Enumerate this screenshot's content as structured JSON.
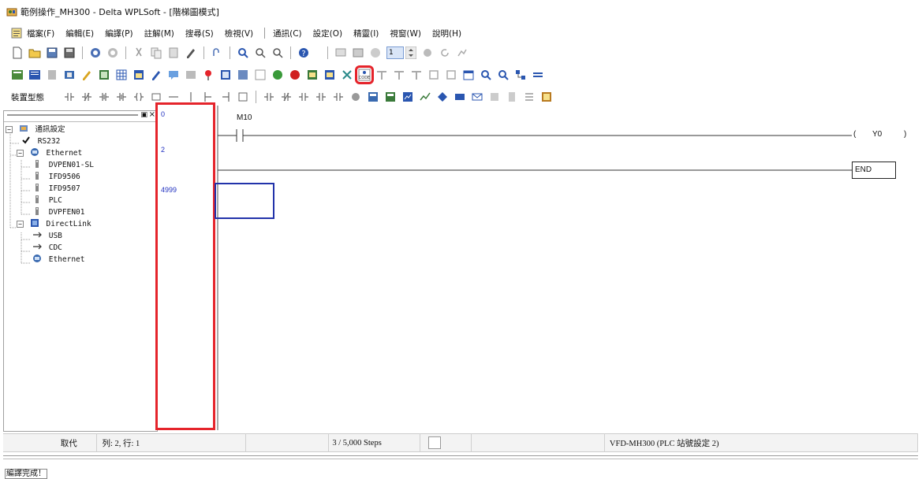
{
  "window": {
    "title": "範例操作_MH300 - Delta WPLSoft - [階梯圖模式]"
  },
  "menu": {
    "items": [
      "檔案(F)",
      "編輯(E)",
      "編譯(P)",
      "註解(M)",
      "搜尋(S)",
      "檢視(V)",
      "通訊(C)",
      "設定(O)",
      "精靈(I)",
      "視窗(W)",
      "說明(H)"
    ]
  },
  "toolbar": {
    "station_value": "1",
    "device_label": "裝置型態"
  },
  "tree": {
    "root": "通訊設定",
    "rs232": "RS232",
    "ethernet": "Ethernet",
    "ethernet_children": [
      "DVPEN01-SL",
      "IFD9506",
      "IFD9507",
      "PLC",
      "DVPFEN01"
    ],
    "directlink": "DirectLink",
    "directlink_children": [
      "USB",
      "CDC",
      "Ethernet"
    ]
  },
  "ladder": {
    "step_numbers": [
      "0",
      "2",
      "4999"
    ],
    "contact": "M10",
    "coil": "Y0",
    "end": "END"
  },
  "status": {
    "mode": "取代",
    "position": "列: 2, 行: 1",
    "steps": "3 / 5,000 Steps",
    "plc_info": "VFD-MH300 (PLC 站號設定 2)"
  },
  "message": {
    "text": "編譯完成！"
  },
  "colors": {
    "highlight": "#e5242b",
    "cursor": "#2233aa",
    "step_number": "#2030c0"
  }
}
